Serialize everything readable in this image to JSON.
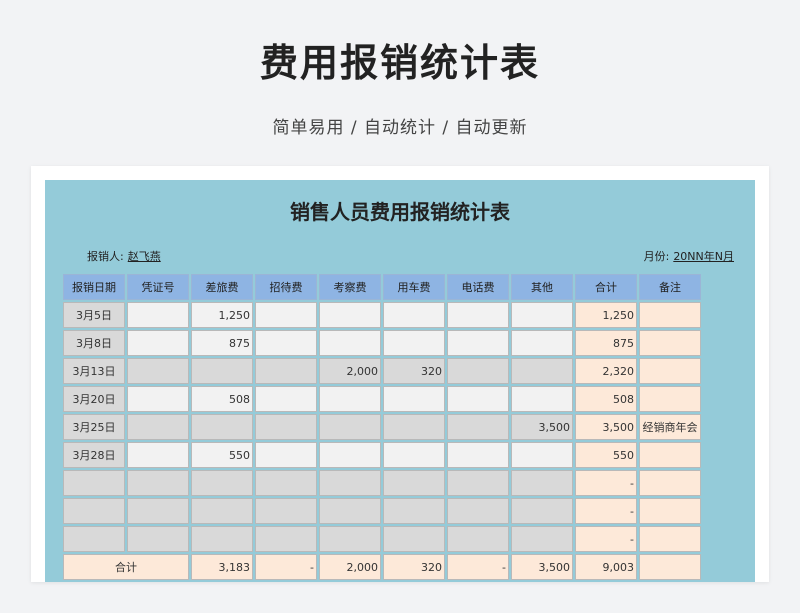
{
  "header": {
    "title": "费用报销统计表",
    "subtitle": "简单易用 / 自动统计 / 自动更新"
  },
  "sheet": {
    "title": "销售人员费用报销统计表",
    "reporter_label": "报销人:",
    "reporter_value": "赵飞燕",
    "month_label": "月份:",
    "month_value": "20NN年N月",
    "columns": [
      "报销日期",
      "凭证号",
      "差旅费",
      "招待费",
      "考察费",
      "用车费",
      "电话费",
      "其他",
      "合计",
      "备注"
    ],
    "rows": [
      [
        "3月5日",
        "",
        "1,250",
        "",
        "",
        "",
        "",
        "",
        "1,250",
        ""
      ],
      [
        "3月8日",
        "",
        "875",
        "",
        "",
        "",
        "",
        "",
        "875",
        ""
      ],
      [
        "3月13日",
        "",
        "",
        "",
        "2,000",
        "320",
        "",
        "",
        "2,320",
        ""
      ],
      [
        "3月20日",
        "",
        "508",
        "",
        "",
        "",
        "",
        "",
        "508",
        ""
      ],
      [
        "3月25日",
        "",
        "",
        "",
        "",
        "",
        "",
        "3,500",
        "3,500",
        "经销商年会"
      ],
      [
        "3月28日",
        "",
        "550",
        "",
        "",
        "",
        "",
        "",
        "550",
        ""
      ],
      [
        "",
        "",
        "",
        "",
        "",
        "",
        "",
        "",
        "-",
        ""
      ],
      [
        "",
        "",
        "",
        "",
        "",
        "",
        "",
        "",
        "-",
        ""
      ],
      [
        "",
        "",
        "",
        "",
        "",
        "",
        "",
        "",
        "-",
        ""
      ]
    ],
    "total_row": [
      "合计",
      "3,183",
      "-",
      "2,000",
      "320",
      "-",
      "3,500",
      "9,003",
      ""
    ]
  }
}
